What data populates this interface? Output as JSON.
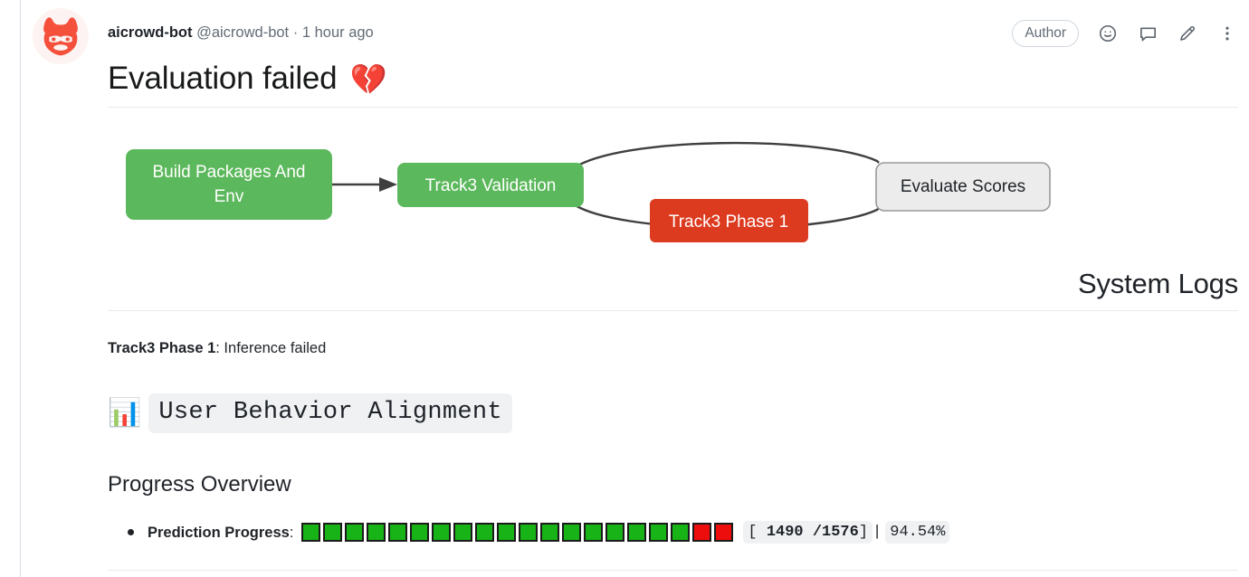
{
  "comment": {
    "author": "aicrowd-bot",
    "handle": "@aicrowd-bot",
    "separator": "·",
    "timestamp": "1 hour ago",
    "author_badge": "Author",
    "title_text": "Evaluation failed",
    "title_emoji": "💔",
    "avatar_name": "aicrowd-bot-avatar"
  },
  "header_actions": [
    {
      "name": "add-reaction-icon",
      "glyph": "smiley"
    },
    {
      "name": "quote-reply-icon",
      "glyph": "comment"
    },
    {
      "name": "edit-comment-icon",
      "glyph": "pencil"
    },
    {
      "name": "more-options-icon",
      "glyph": "kebab"
    }
  ],
  "diagram": {
    "nodes": [
      {
        "id": "build",
        "label": "Build Packages And Env",
        "state": "success",
        "color": "#5cb85c",
        "text_color": "#ffffff"
      },
      {
        "id": "validation",
        "label": "Track3 Validation",
        "state": "success",
        "color": "#5cb85c",
        "text_color": "#ffffff"
      },
      {
        "id": "phase1",
        "label": "Track3 Phase 1",
        "state": "failed",
        "color": "#dd3b20",
        "text_color": "#ffffff"
      },
      {
        "id": "evaluate",
        "label": "Evaluate Scores",
        "state": "pending",
        "color": "#ececec",
        "text_color": "#1f2328"
      }
    ],
    "edge_color": "#3f3f3f"
  },
  "logs": {
    "heading": "System Logs",
    "phase_name": "Track3 Phase 1",
    "phase_status": ": Inference failed",
    "code_emoji": "📊",
    "code_title": "User Behavior Alignment"
  },
  "progress": {
    "section_heading": "Progress Overview",
    "item_label": "Prediction Progress",
    "colon": ":",
    "squares": [
      "green",
      "green",
      "green",
      "green",
      "green",
      "green",
      "green",
      "green",
      "green",
      "green",
      "green",
      "green",
      "green",
      "green",
      "green",
      "green",
      "green",
      "green",
      "red",
      "red"
    ],
    "green_color": "#17b317",
    "red_color": "#ee0d0d",
    "count_prefix": "[ ",
    "count_current": "1490",
    "count_divider": " /",
    "count_total": "1576",
    "count_suffix": "]",
    "pipe": "|",
    "percent": "94.54%"
  }
}
